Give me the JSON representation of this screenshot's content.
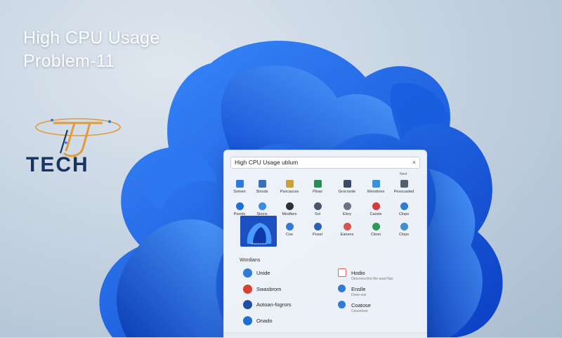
{
  "headline": {
    "line1": "High CPU Usage",
    "line2": "Problem-11"
  },
  "logo": {
    "text": "TECH"
  },
  "start_menu": {
    "search_value": "High CPU Usage ublum",
    "close_glyph": "×",
    "pinned_more": "Next",
    "tiles_row1": [
      {
        "label": "Somen",
        "icon": "settings-icon",
        "color": "#2f7bd6"
      },
      {
        "label": "Stoods",
        "icon": "app-icon",
        "color": "#3a6fb0"
      },
      {
        "label": "Psocasces",
        "icon": "explorer-icon",
        "color": "#c9a23a"
      },
      {
        "label": "Plnas",
        "icon": "app-icon",
        "color": "#2a8a5c"
      },
      {
        "label": "Grocrante",
        "icon": "app-icon",
        "color": "#3a4a66"
      },
      {
        "label": "Weodsres",
        "icon": "app-icon",
        "color": "#3c8fd8"
      },
      {
        "label": "Pesocasted",
        "icon": "app-icon",
        "color": "#555e70"
      }
    ],
    "tiles_row2": [
      {
        "label": "Psonls",
        "icon": "app-icon",
        "color": "#1f6fd0"
      },
      {
        "label": "Stions",
        "icon": "app-icon",
        "color": "#3d8be0"
      },
      {
        "label": "Mosfters",
        "icon": "app-icon",
        "color": "#2a2f3a"
      },
      {
        "label": "Sol",
        "icon": "app-icon",
        "color": "#4a5568"
      },
      {
        "label": "Elsry",
        "icon": "app-icon",
        "color": "#6b7487"
      },
      {
        "label": "Caosle",
        "icon": "app-icon",
        "color": "#d23d3d"
      },
      {
        "label": "Clops",
        "icon": "app-icon",
        "color": "#2f7bd6"
      }
    ],
    "tiles_row3": [
      {
        "label": "Coe",
        "icon": "app-icon",
        "color": "#2f7bd6"
      },
      {
        "label": "Posel",
        "icon": "app-icon",
        "color": "#2b60b8"
      },
      {
        "label": "Eanens",
        "icon": "app-icon",
        "color": "#d9534f"
      },
      {
        "label": "Cleon",
        "icon": "app-icon",
        "color": "#2d9a55"
      },
      {
        "label": "Clops",
        "icon": "app-icon",
        "color": "#3f8fd1"
      }
    ],
    "thumb_label": "Wiskrbantcs",
    "section_title": "Wordians",
    "left_items": [
      {
        "title": "Unide",
        "color": "#2f7bd6"
      },
      {
        "title": "Swasbrom",
        "color": "#d8412f"
      },
      {
        "title": "Aotoan-fogrors",
        "color": "#1f4fa3"
      },
      {
        "title": "Onado",
        "color": "#1f6fd0"
      }
    ],
    "right_items": [
      {
        "title": "Hodio",
        "sub": "Oenconcctrto the eeal Hao"
      },
      {
        "title": "Enslle",
        "sub": "Doee ese"
      },
      {
        "title": "Coatose",
        "sub": "Ceosnloxe"
      }
    ]
  }
}
